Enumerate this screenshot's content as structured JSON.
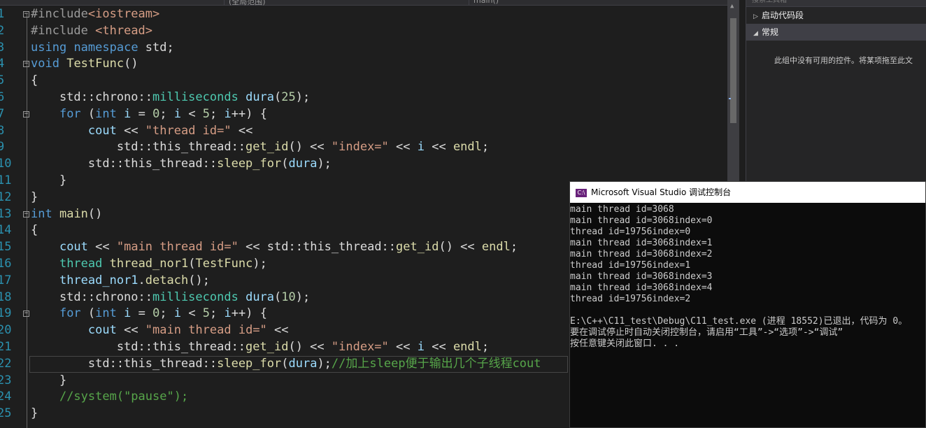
{
  "editor": {
    "nav_left": "(全局范围)",
    "nav_right": "main()",
    "lines": [
      {
        "n": "1",
        "fold": "−",
        "html": "<span class=\"pp\">#include</span><span class=\"str\">&lt;iostream&gt;</span>"
      },
      {
        "n": "2",
        "fold": "",
        "html": "<span class=\"pp\">#include</span> <span class=\"str\">&lt;thread&gt;</span>"
      },
      {
        "n": "3",
        "fold": "",
        "html": "<span class=\"kw\">using</span> <span class=\"kw\">namespace</span> std;"
      },
      {
        "n": "4",
        "fold": "−",
        "html": "<span class=\"kw\">void</span> <span class=\"fn\">TestFunc</span>()"
      },
      {
        "n": "5",
        "fold": "",
        "html": "{"
      },
      {
        "n": "6",
        "fold": "",
        "html": "    std::chrono::<span class=\"typ\">milliseconds</span> <span class=\"var\">dura</span>(<span class=\"num\">25</span>);"
      },
      {
        "n": "7",
        "fold": "−",
        "html": "    <span class=\"kw\">for</span> (<span class=\"kw\">int</span> <span class=\"var\">i</span> = <span class=\"num\">0</span>; <span class=\"var\">i</span> &lt; <span class=\"num\">5</span>; <span class=\"var\">i</span>++) {"
      },
      {
        "n": "8",
        "fold": "",
        "html": "        <span class=\"var\">cout</span> &lt;&lt; <span class=\"str\">\"thread id=\"</span> &lt;&lt;"
      },
      {
        "n": "9",
        "fold": "",
        "html": "            std::this_thread::<span class=\"fn\">get_id</span>() &lt;&lt; <span class=\"str\">\"index=\"</span> &lt;&lt; <span class=\"var\">i</span> &lt;&lt; <span class=\"fn\">endl</span>;"
      },
      {
        "n": "10",
        "fold": "",
        "html": "        std::this_thread::<span class=\"fn\">sleep_for</span>(<span class=\"var\">dura</span>);"
      },
      {
        "n": "11",
        "fold": "",
        "html": "    }"
      },
      {
        "n": "12",
        "fold": "",
        "html": "}"
      },
      {
        "n": "13",
        "fold": "−",
        "html": "<span class=\"kw\">int</span> <span class=\"fn\">main</span>()"
      },
      {
        "n": "14",
        "fold": "",
        "html": "{"
      },
      {
        "n": "15",
        "fold": "",
        "html": "    <span class=\"var\">cout</span> &lt;&lt; <span class=\"str\">\"main thread id=\"</span> &lt;&lt; std::this_thread::<span class=\"fn\">get_id</span>() &lt;&lt; <span class=\"fn\">endl</span>;"
      },
      {
        "n": "16",
        "fold": "",
        "html": "    <span class=\"typ\">thread</span> <span class=\"fn\">thread_nor1</span>(<span class=\"fn\">TestFunc</span>);"
      },
      {
        "n": "17",
        "fold": "",
        "html": "    <span class=\"var\">thread_nor1</span>.<span class=\"fn\">detach</span>();"
      },
      {
        "n": "18",
        "fold": "",
        "html": "    std::chrono::<span class=\"typ\">milliseconds</span> <span class=\"var\">dura</span>(<span class=\"num\">10</span>);"
      },
      {
        "n": "19",
        "fold": "−",
        "html": "    <span class=\"kw\">for</span> (<span class=\"kw\">int</span> <span class=\"var\">i</span> = <span class=\"num\">0</span>; <span class=\"var\">i</span> &lt; <span class=\"num\">5</span>; <span class=\"var\">i</span>++) {"
      },
      {
        "n": "20",
        "fold": "",
        "html": "        <span class=\"var\">cout</span> &lt;&lt; <span class=\"str\">\"main thread id=\"</span> &lt;&lt;"
      },
      {
        "n": "21",
        "fold": "",
        "html": "            std::this_thread::<span class=\"fn\">get_id</span>() &lt;&lt; <span class=\"str\">\"index=\"</span> &lt;&lt; <span class=\"var\">i</span> &lt;&lt; <span class=\"fn\">endl</span>;"
      },
      {
        "n": "22",
        "fold": "",
        "hl": true,
        "html": "        std::this_thread::<span class=\"fn\">sleep_for</span>(<span class=\"var\">dura</span>);<span class=\"cm\">//加上sleep便于输出几个子线程cout</span>"
      },
      {
        "n": "23",
        "fold": "",
        "html": "    }"
      },
      {
        "n": "24",
        "fold": "",
        "html": "    <span class=\"cm\">//system(\"pause\");</span>"
      },
      {
        "n": "25",
        "fold": "",
        "html": "}"
      }
    ]
  },
  "toolbox": {
    "search_placeholder": "搜索工具箱",
    "groups": [
      {
        "label": "启动代码段",
        "expanded": false
      },
      {
        "label": "常规",
        "expanded": true
      }
    ],
    "empty_message": "此组中没有可用的控件。将某项拖至此文"
  },
  "console": {
    "title": "Microsoft Visual Studio 调试控制台",
    "icon": "vs-console-icon",
    "lines": [
      "main thread id=3068",
      "main thread id=3068index=0",
      "thread id=19756index=0",
      "main thread id=3068index=1",
      "main thread id=3068index=2",
      "thread id=19756index=1",
      "main thread id=3068index=3",
      "main thread id=3068index=4",
      "thread id=19756index=2",
      "",
      "E:\\C++\\C11_test\\Debug\\C11_test.exe (进程 18552)已退出，代码为 0。",
      "要在调试停止时自动关闭控制台，请启用“工具”->“选项”->“调试”",
      "按任意键关闭此窗口. . ."
    ]
  },
  "colors": {
    "editor_bg": "#1e1e1e",
    "keyword": "#569cd6",
    "string": "#d69d85",
    "type": "#4ec9b0",
    "function": "#dcdcaa",
    "comment": "#57a64a",
    "line_number": "#2b91af"
  }
}
